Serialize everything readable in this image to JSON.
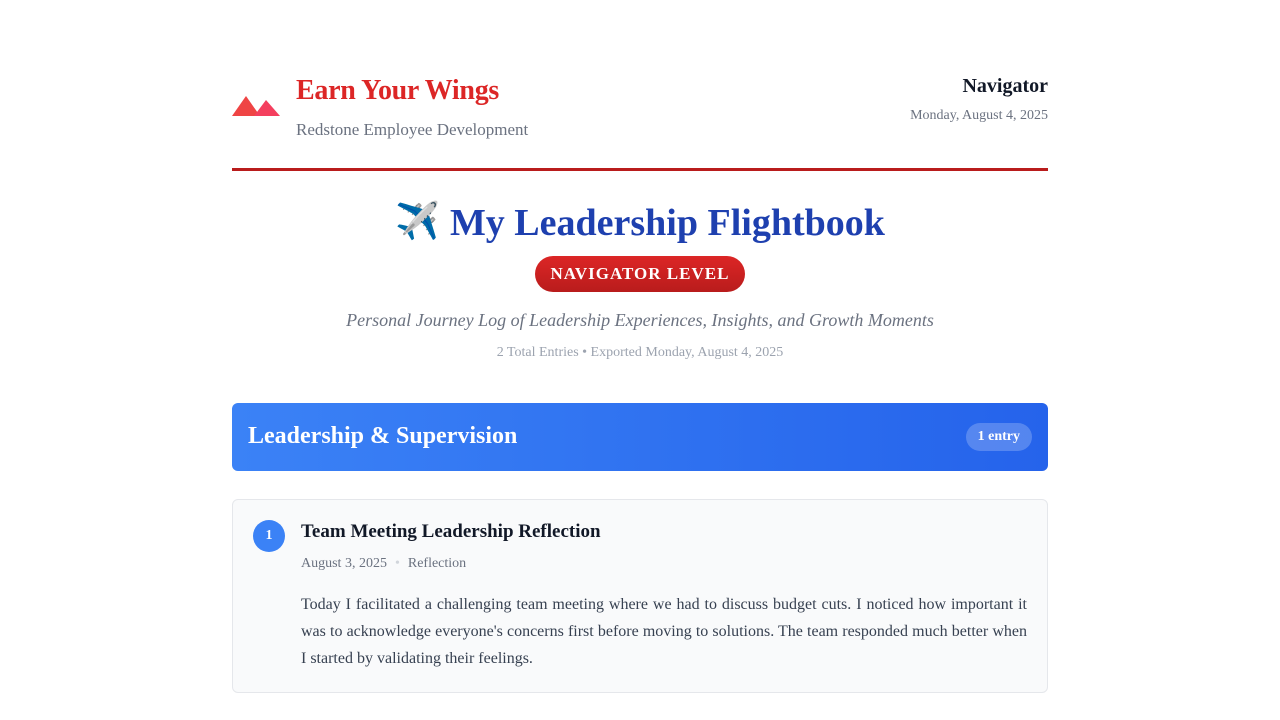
{
  "header": {
    "brand_title": "Earn Your Wings",
    "brand_subtitle": "Redstone Employee Development",
    "level_name": "Navigator",
    "date": "Monday, August 4, 2025",
    "logo_icon": "mountain-logo-icon"
  },
  "title_block": {
    "icon": "✈️",
    "title": "My Leadership Flightbook",
    "level_badge": "NAVIGATOR LEVEL",
    "subtitle": "Personal Journey Log of Leadership Experiences, Insights, and Growth Moments",
    "meta": "2 Total Entries • Exported Monday, August 4, 2025"
  },
  "categories": [
    {
      "title": "Leadership & Supervision",
      "count_label": "1 entry",
      "entries": [
        {
          "number": "1",
          "title": "Team Meeting Leadership Reflection",
          "date": "August 3, 2025",
          "separator": "•",
          "type": "Reflection",
          "body": "Today I facilitated a challenging team meeting where we had to discuss budget cuts. I noticed how important it was to acknowledge everyone's concerns first before moving to solutions. The team responded much better when I started by validating their feelings."
        }
      ]
    }
  ],
  "colors": {
    "brand_red": "#dc2626",
    "title_blue": "#1e40af",
    "category_blue": "#3b82f6",
    "text_gray": "#6b7280"
  }
}
